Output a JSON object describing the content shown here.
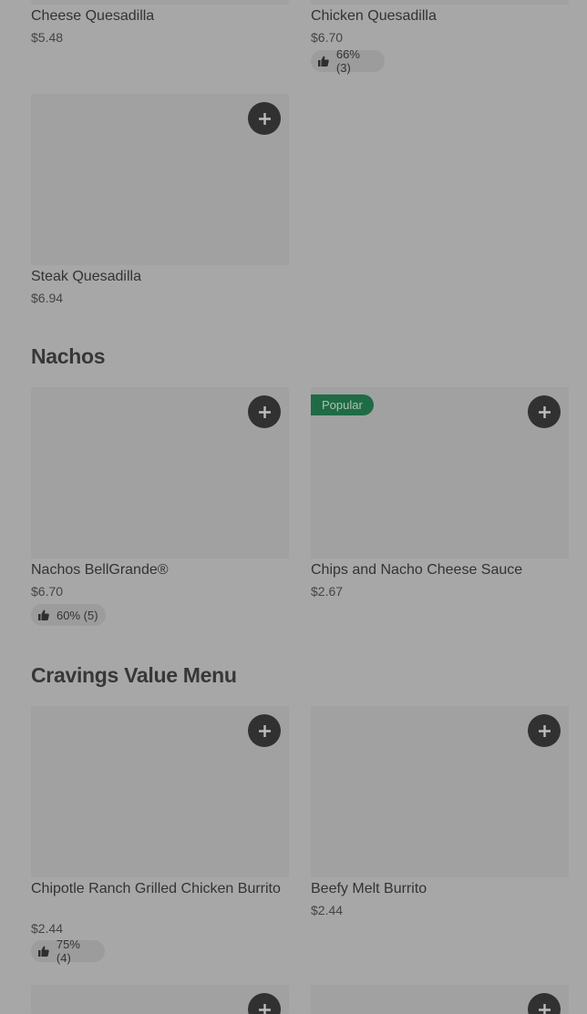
{
  "sections": {
    "nachos": "Nachos",
    "value": "Cravings Value Menu"
  },
  "items": {
    "cheese_quesadilla": {
      "name": "Cheese Quesadilla",
      "price": "$5.48"
    },
    "chicken_quesadilla": {
      "name": "Chicken Quesadilla",
      "price": "$6.70",
      "rating": "66% (3)"
    },
    "steak_quesadilla": {
      "name": "Steak Quesadilla",
      "price": "$6.94"
    },
    "nachos_bellgrande": {
      "name": "Nachos BellGrande®",
      "price": "$6.70",
      "rating": "60% (5)"
    },
    "chips_cheese": {
      "name": "Chips and Nacho Cheese Sauce",
      "price": "$2.67",
      "badge": "Popular"
    },
    "chipotle_burrito": {
      "name": "Chipotle Ranch Grilled Chicken Burrito",
      "price": "$2.44",
      "rating": "75% (4)"
    },
    "beefy_melt": {
      "name": "Beefy Melt Burrito",
      "price": "$2.44"
    }
  },
  "icons": {
    "add": "plus-icon",
    "rating": "thumbs-up-icon"
  },
  "colors": {
    "background": "#a7a7a7",
    "button": "#313131",
    "badge": "#1f6b45"
  }
}
